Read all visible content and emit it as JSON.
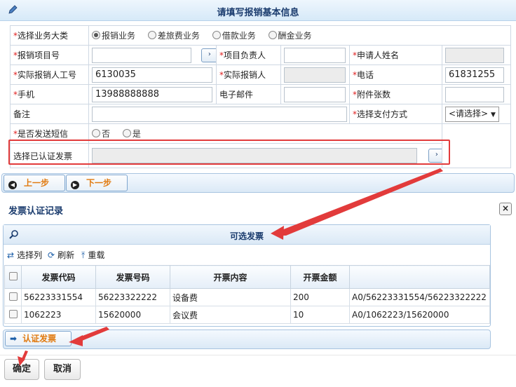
{
  "form": {
    "title": "请填写报销基本信息",
    "business_category_label": "选择业务大类",
    "business_options": [
      "报销业务",
      "差旅费业务",
      "借款业务",
      "酬金业务"
    ],
    "selected_business": "报销业务",
    "project_no_label": "报销项目号",
    "project_no_value": "",
    "go_glyph": "›",
    "project_owner_label": "项目负责人",
    "project_owner_value": "",
    "applicant_name_label": "申请人姓名",
    "actual_staff_no_label": "实际报销人工号",
    "actual_staff_no_value": "6130035",
    "actual_person_label": "实际报销人",
    "phone_label": "电话",
    "phone_value": "61831255",
    "mobile_label": "手机",
    "mobile_value": "13988888888",
    "email_label": "电子邮件",
    "email_value": "",
    "attachments_label": "附件张数",
    "attachments_value": "",
    "remarks_label": "备注",
    "remarks_value": "",
    "payment_method_label": "选择支付方式",
    "payment_method_value": "<请选择>",
    "payment_caret": "▼",
    "sms_label": "是否发送短信",
    "sms_options": [
      "否",
      "是"
    ],
    "invoice_label": "选择已认证发票",
    "invoice_value": ""
  },
  "steps": {
    "prev_label": "上一步",
    "next_label": "下一步",
    "prev_glyph": "◀",
    "next_glyph": "▶"
  },
  "dialog": {
    "title": "发票认证记录",
    "close_glyph": "×",
    "panel_title": "可选发票",
    "toolbar": {
      "select_columns": "选择列",
      "refresh": "刷新",
      "reload": "重载"
    },
    "columns": [
      "发票代码",
      "发票号码",
      "开票内容",
      "开票金额",
      ""
    ],
    "rows": [
      [
        "56223331554",
        "56223322222",
        "设备费",
        "200",
        "A0/56223331554/56223322222"
      ],
      [
        "1062223",
        "15620000",
        "会议费",
        "10",
        "A0/1062223/15620000"
      ]
    ],
    "certify_label": "认证发票",
    "certify_glyph": "➡",
    "confirm_label": "确定",
    "cancel_label": "取消"
  },
  "colors": {
    "highlight_red": "#e23b3b",
    "link_orange": "#e07a10",
    "header_blue": "#1b3c6e"
  }
}
